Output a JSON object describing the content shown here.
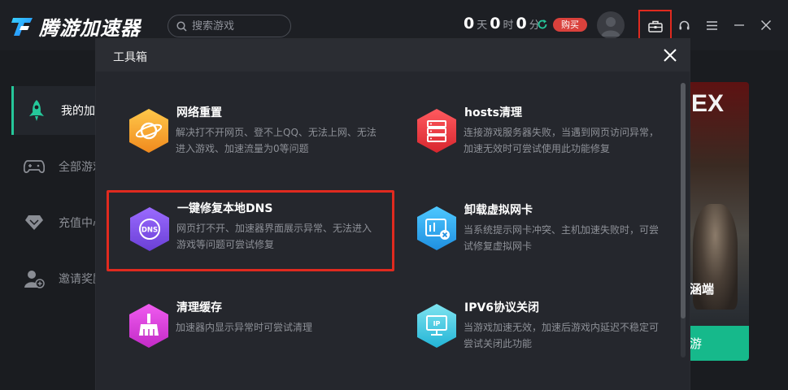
{
  "app": {
    "logo_text": "腾游加速器",
    "search_placeholder": "搜索游戏",
    "timer": {
      "days": "0",
      "days_unit": "天",
      "hours": "0",
      "hours_unit": "时",
      "minutes": "0",
      "minutes_unit": "分"
    },
    "buy_label": "购买"
  },
  "sidebar": {
    "items": [
      {
        "label": "我的加速",
        "icon": "rocket-icon",
        "active": true
      },
      {
        "label": "全部游戏",
        "icon": "gamepad-icon",
        "active": false
      },
      {
        "label": "充值中心",
        "icon": "diamond-icon",
        "active": false
      },
      {
        "label": "邀请奖励",
        "icon": "add-user-icon",
        "active": false
      }
    ]
  },
  "banner": {
    "logo_text": "EX",
    "caption": "涵端",
    "button_text": "游"
  },
  "modal": {
    "title": "工具箱",
    "tools": [
      {
        "title": "网络重置",
        "desc": "解决打不开网页、登不上QQ、无法上网、无法进入游戏、加速流量为0等问题",
        "icon": "planet-icon",
        "color": "#f2a72a"
      },
      {
        "title": "hosts清理",
        "desc": "连接游戏服务器失败，当遇到网页访问异常，加速无效时可尝试使用此功能修复",
        "icon": "server-icon",
        "color": "#e8383f"
      },
      {
        "title": "一键修复本地DNS",
        "desc": "网页打不开、加速器界面展示异常、无法进入游戏等问题可尝试修复",
        "icon": "dns-icon",
        "color": "#7b4fe0"
      },
      {
        "title": "卸载虚拟网卡",
        "desc": "当系统提示网卡冲突、主机加速失败时，可尝试修复虚拟网卡",
        "icon": "network-card-icon",
        "color": "#2aa8e8"
      },
      {
        "title": "清理缓存",
        "desc": "加速器内显示异常时可尝试清理",
        "icon": "broom-icon",
        "color": "#d83ad6"
      },
      {
        "title": "IPV6协议关闭",
        "desc": "当游戏加速无效，加速后游戏内延迟不稳定可尝试关闭此功能",
        "icon": "ip-monitor-icon",
        "color": "#35c8e0"
      }
    ]
  }
}
